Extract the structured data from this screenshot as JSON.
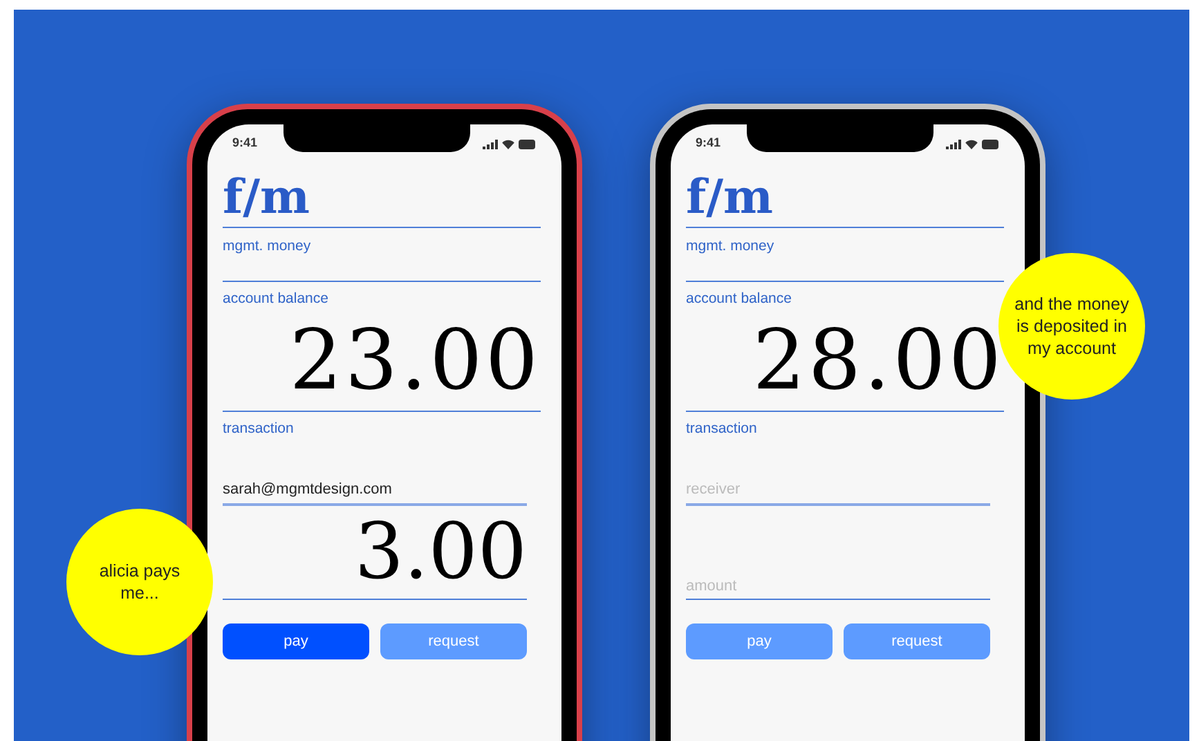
{
  "phones": [
    {
      "color": "#d8404a",
      "status_time": "9:41",
      "logo": "f/m",
      "app_name": "mgmt. money",
      "balance_label": "account balance",
      "balance": "23.00",
      "transaction_label": "transaction",
      "receiver": {
        "value": "sarah@mgmtdesign.com"
      },
      "amount": {
        "value": "3.00"
      },
      "buttons": [
        {
          "label": "pay",
          "selected": true
        },
        {
          "label": "request",
          "selected": false
        }
      ]
    },
    {
      "color": "#c4c4c4",
      "status_time": "9:41",
      "logo": "f/m",
      "app_name": "mgmt. money",
      "balance_label": "account balance",
      "balance": "28.00",
      "transaction_label": "transaction",
      "receiver": {
        "placeholder": "receiver"
      },
      "amount": {
        "placeholder": "amount"
      },
      "buttons": [
        {
          "label": "pay",
          "selected": false
        },
        {
          "label": "request",
          "selected": false
        }
      ]
    }
  ],
  "callouts": [
    "alicia pays me...",
    "and the money is deposited in my account"
  ]
}
